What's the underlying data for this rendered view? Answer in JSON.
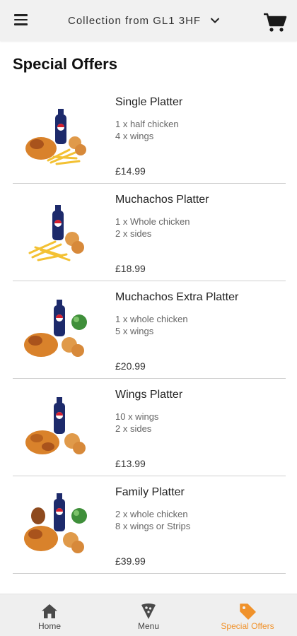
{
  "header": {
    "location_label": "Collection from GL1 3HF",
    "menu_icon": "hamburger-menu-icon",
    "dropdown_icon": "chevron-down-icon",
    "cart_icon": "shopping-cart-icon"
  },
  "page": {
    "title": "Special Offers"
  },
  "items": [
    {
      "name": "Single Platter",
      "desc": [
        "1 x half chicken",
        "4 x wings"
      ],
      "price": "£14.99"
    },
    {
      "name": "Muchachos Platter",
      "desc": [
        "1 x Whole chicken",
        "2 x sides"
      ],
      "price": "£18.99"
    },
    {
      "name": "Muchachos Extra Platter",
      "desc": [
        "1 x whole chicken",
        "5 x wings"
      ],
      "price": "£20.99"
    },
    {
      "name": "Wings Platter",
      "desc": [
        "10 x wings",
        "2 x sides"
      ],
      "price": "£13.99"
    },
    {
      "name": "Family Platter",
      "desc": [
        "2 x whole chicken",
        "8 x wings or Strips"
      ],
      "price": "£39.99"
    }
  ],
  "nav": {
    "home": {
      "label": "Home",
      "icon": "home-icon"
    },
    "menu": {
      "label": "Menu",
      "icon": "pizza-slice-icon"
    },
    "offers": {
      "label": "Special Offers",
      "icon": "tag-icon",
      "active": true
    }
  },
  "colors": {
    "accent": "#f0922b",
    "header_bg": "#f1f1f1",
    "nav_bg": "#efefef"
  }
}
